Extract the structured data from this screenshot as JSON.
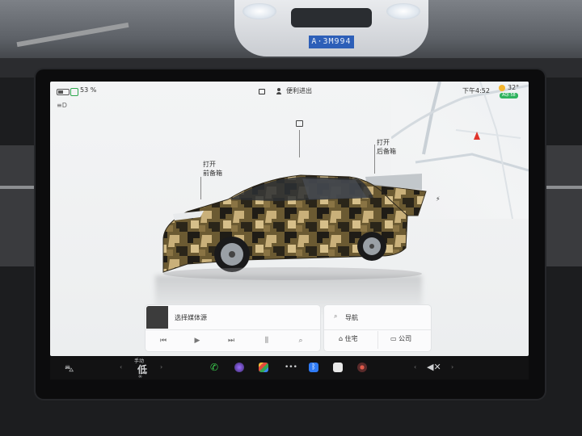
{
  "scene": {
    "front_plate": "A·3M994"
  },
  "status_bar": {
    "battery_percent": "53 %",
    "profile_name": "便利进出",
    "time": "下午4:52",
    "temperature": "32°",
    "air_quality_badge": "AQI 58"
  },
  "vehicle": {
    "frunk_label_line1": "打开",
    "frunk_label_line2": "前备箱",
    "trunk_label_line1": "打开",
    "trunk_label_line2": "后备箱"
  },
  "media": {
    "title": "选择媒体源",
    "controls": [
      "⏮",
      "▶",
      "⏭",
      "⫼",
      "⌕"
    ]
  },
  "navigation": {
    "search_label": "导航",
    "home_label": "住宅",
    "work_label": "公司"
  },
  "dock": {
    "drive_mode_label": "手动",
    "fan_speed": "低",
    "mute_symbol": "✕"
  },
  "colors": {
    "accent_green": "#2fb35f",
    "phone_green": "#3ccf4e",
    "bluetooth_blue": "#2f7bf6",
    "nav_red": "#e0342b"
  }
}
